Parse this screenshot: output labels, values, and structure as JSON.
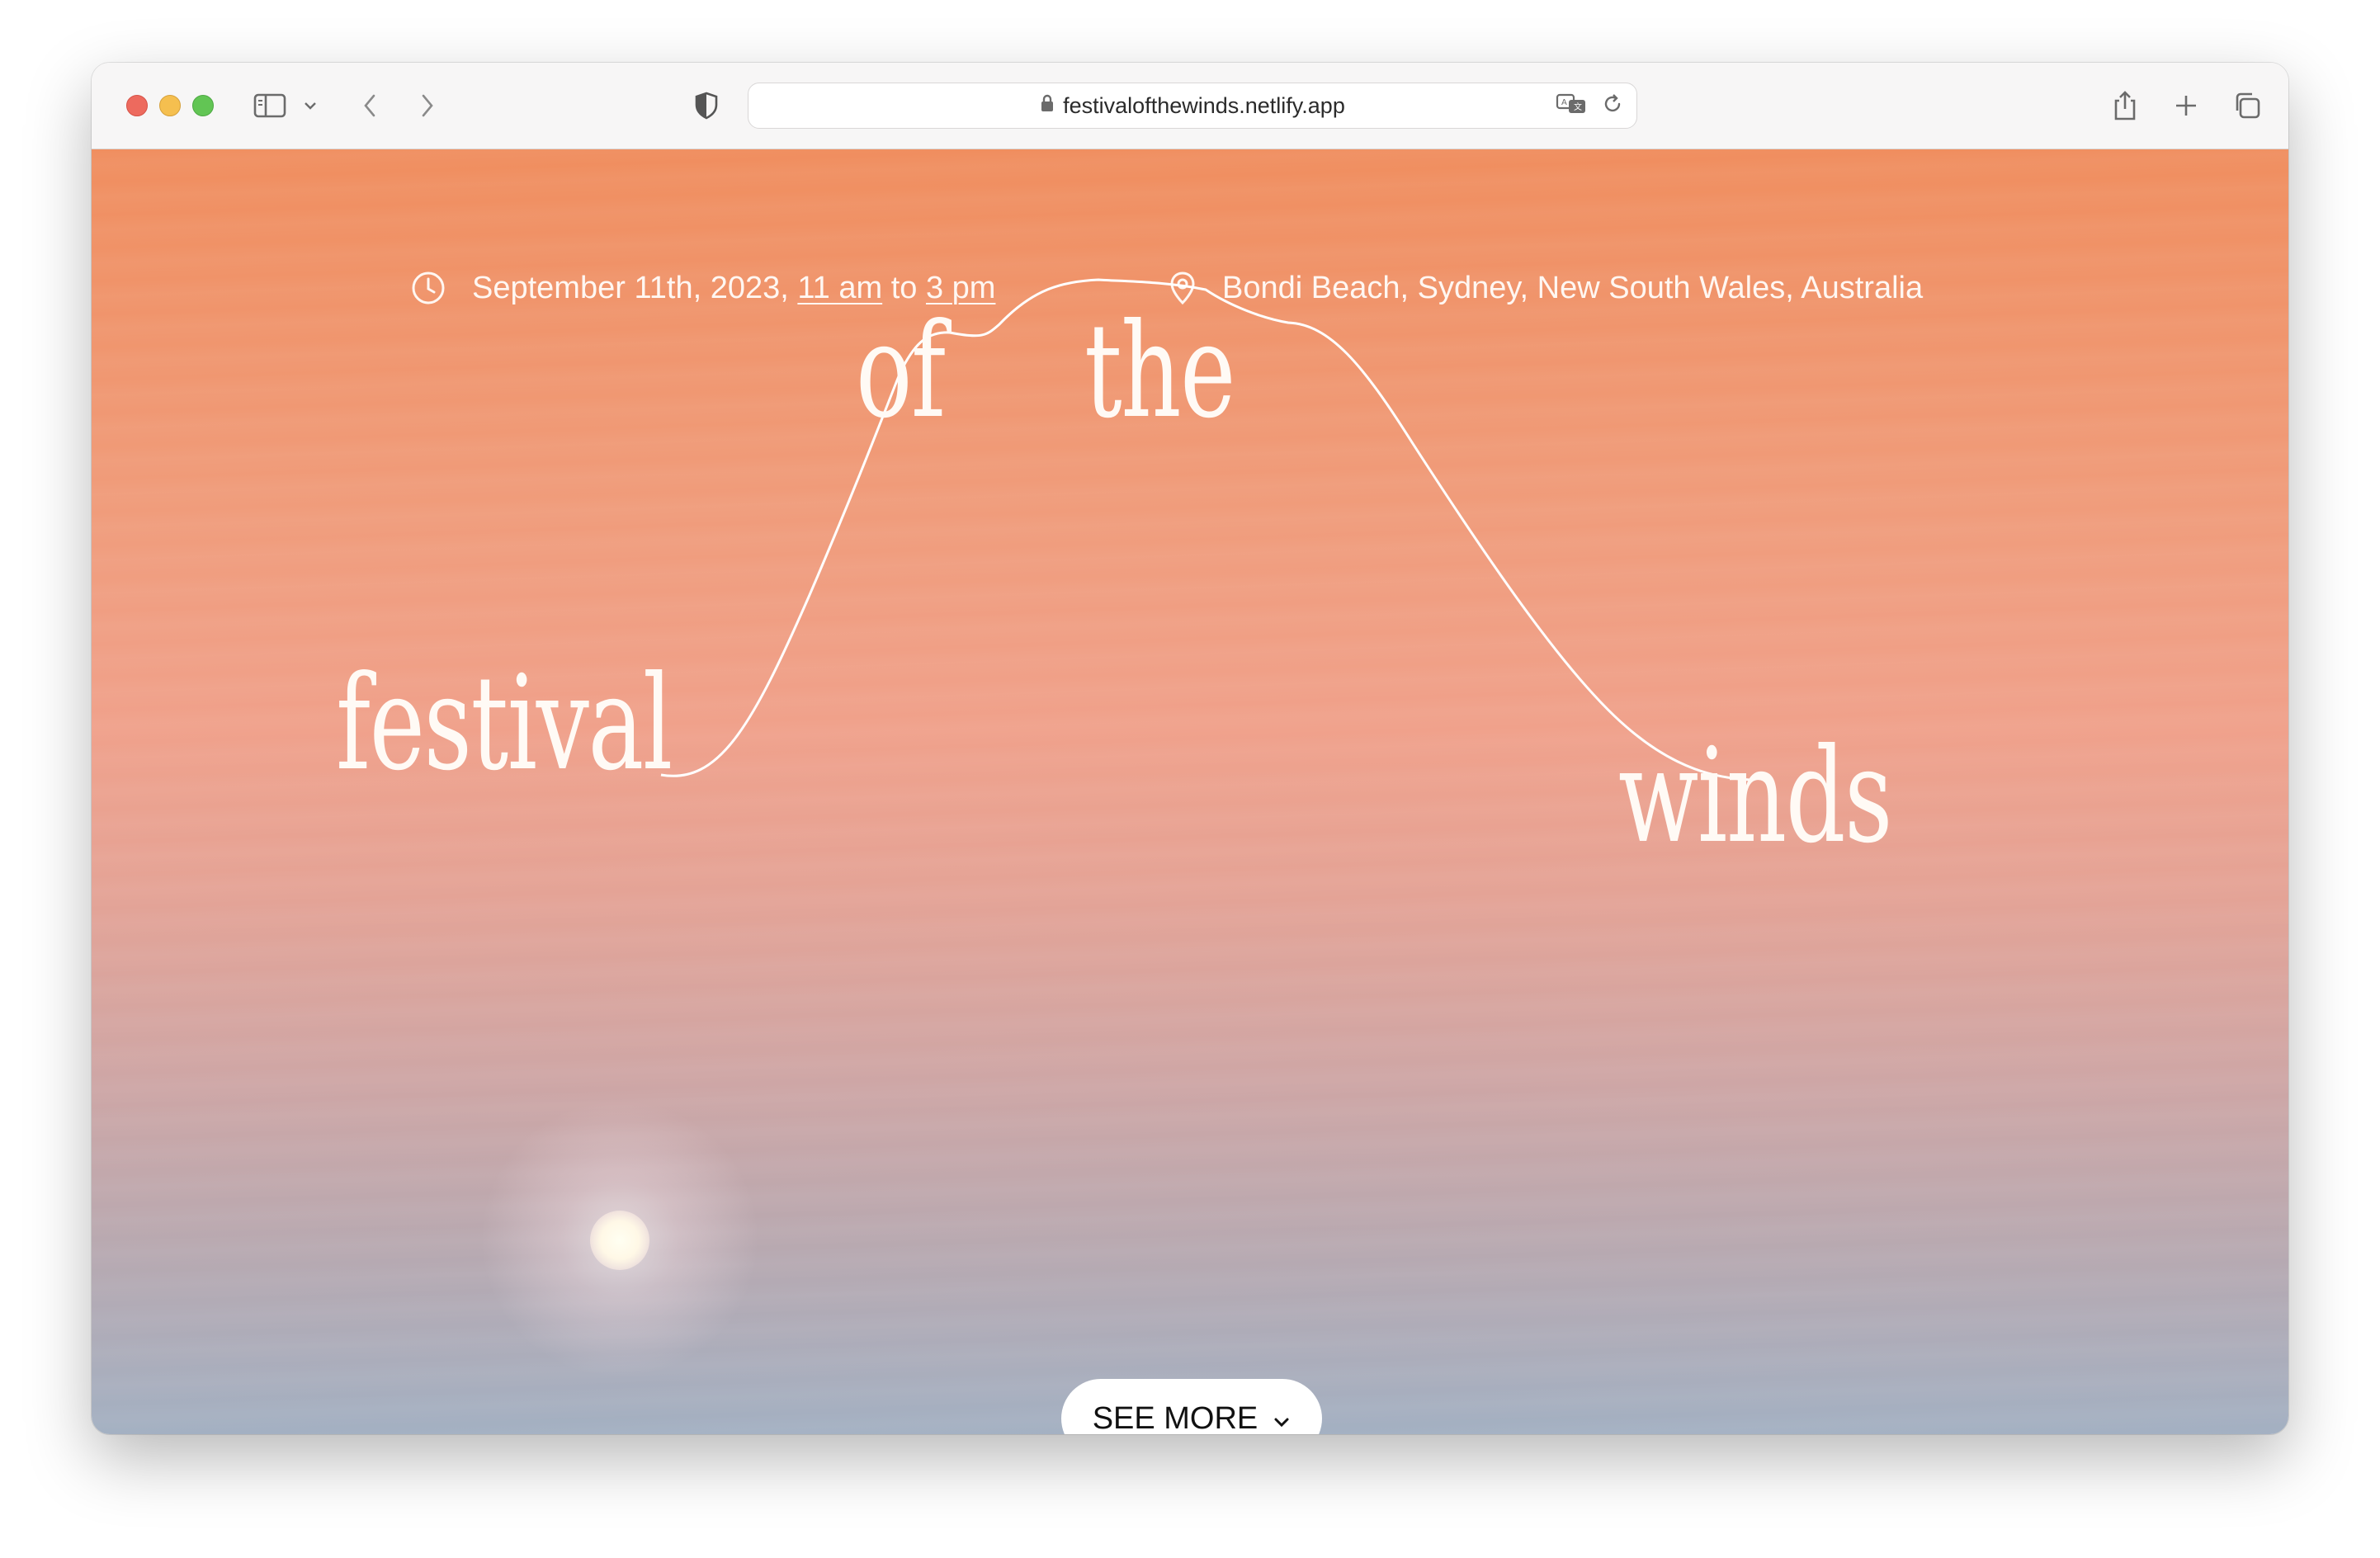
{
  "browser": {
    "url": "festivalofthewinds.netlify.app",
    "icons": {
      "sidebar": "sidebar-icon",
      "chevron": "chevron-down-icon",
      "back": "back-arrow-icon",
      "forward": "forward-arrow-icon",
      "shield": "privacy-shield-icon",
      "lock": "lock-icon",
      "translate": "translate-icon",
      "reload": "reload-icon",
      "share": "share-icon",
      "new_tab": "plus-icon",
      "tabs": "tabs-overview-icon"
    }
  },
  "event": {
    "date_prefix": "September 11th, 2023,",
    "start_time": "11 am",
    "connector": "to",
    "end_time": "3 pm",
    "location": "Bondi Beach, Sydney, New South Wales, Australia"
  },
  "title": {
    "word1": "festival",
    "word2": "of",
    "word3": "the",
    "word4": "winds"
  },
  "cta": {
    "label": "SEE MORE"
  },
  "colors": {
    "sky_top": "#f08e5f",
    "sky_mid": "#f0a18b",
    "sky_bottom": "#a3b0c2",
    "text": "#fffaf5"
  }
}
